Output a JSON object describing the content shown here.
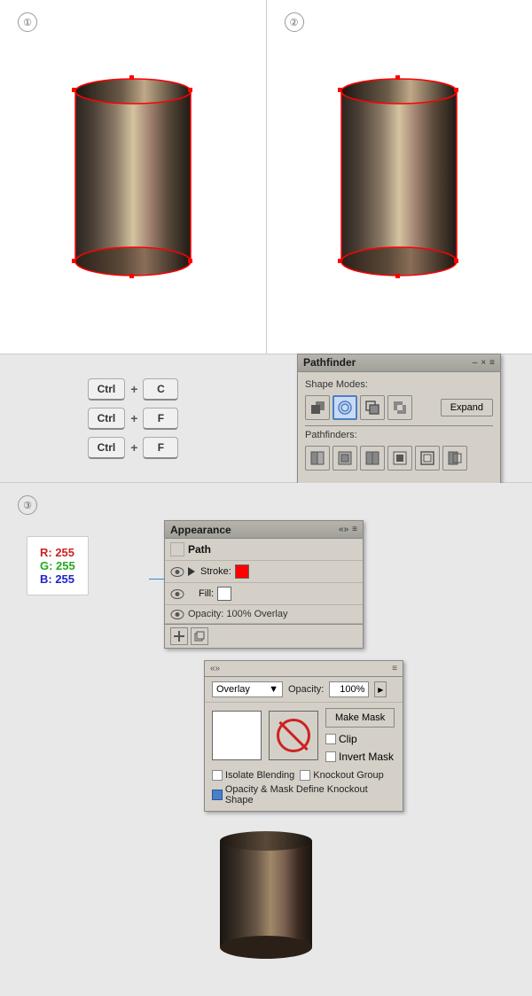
{
  "panels": {
    "panel1_number": "①",
    "panel2_number": "②",
    "panel3_number": "③"
  },
  "keyboard": {
    "row1": {
      "key1": "Ctrl",
      "plus": "+",
      "key2": "C"
    },
    "row2": {
      "key1": "Ctrl",
      "plus": "+",
      "key2": "F"
    },
    "row3": {
      "key1": "Ctrl",
      "plus": "+",
      "key2": "F"
    }
  },
  "pathfinder": {
    "title": "Pathfinder",
    "shape_modes_label": "Shape Modes:",
    "pathfinders_label": "Pathfinders:",
    "expand_label": "Expand",
    "controls": {
      "close": "×",
      "minimize": "–"
    }
  },
  "appearance": {
    "title": "Appearance",
    "path_label": "Path",
    "stroke_label": "Stroke:",
    "fill_label": "Fill:",
    "opacity_label": "Opacity: 100% Overlay"
  },
  "transparency": {
    "blend_mode": "Overlay",
    "opacity_label": "Opacity:",
    "opacity_value": "100%",
    "make_mask_label": "Make Mask",
    "clip_label": "Clip",
    "invert_mask_label": "Invert Mask",
    "isolate_blending_label": "Isolate Blending",
    "knockout_group_label": "Knockout Group",
    "opacity_mask_label": "Opacity & Mask Define Knockout Shape"
  },
  "colors": {
    "r_label": "R: 255",
    "g_label": "G: 255",
    "b_label": "B: 255"
  }
}
